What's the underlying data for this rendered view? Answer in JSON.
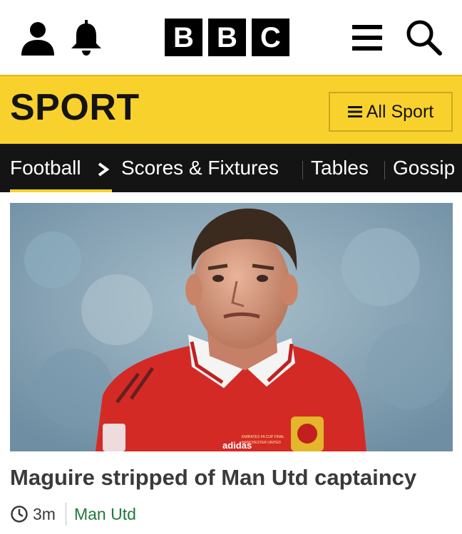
{
  "header": {
    "logo_letters": [
      "B",
      "B",
      "C"
    ],
    "icons": {
      "account": "account-icon",
      "notifications": "bell-icon",
      "menu": "menu-icon",
      "search": "search-icon"
    }
  },
  "sport_header": {
    "title": "SPORT",
    "all_sport_label": "All Sport",
    "background_color": "#f9d12d"
  },
  "nav": {
    "items": [
      {
        "label": "Football",
        "active": true
      },
      {
        "label": "Scores & Fixtures"
      },
      {
        "label": "Tables"
      },
      {
        "label": "Gossip"
      }
    ],
    "active_underline_color": "#f9d12d"
  },
  "article": {
    "headline": "Maguire stripped of Man Utd captaincy",
    "timestamp": "3m",
    "topic": "Man Utd",
    "topic_color": "#1e7a3c",
    "image": {
      "kit_text_brand": "adidas",
      "kit_text_badge": "EMIRATES FA CUP FINAL",
      "kit_text_club": "MANCHESTER UNITED"
    }
  }
}
